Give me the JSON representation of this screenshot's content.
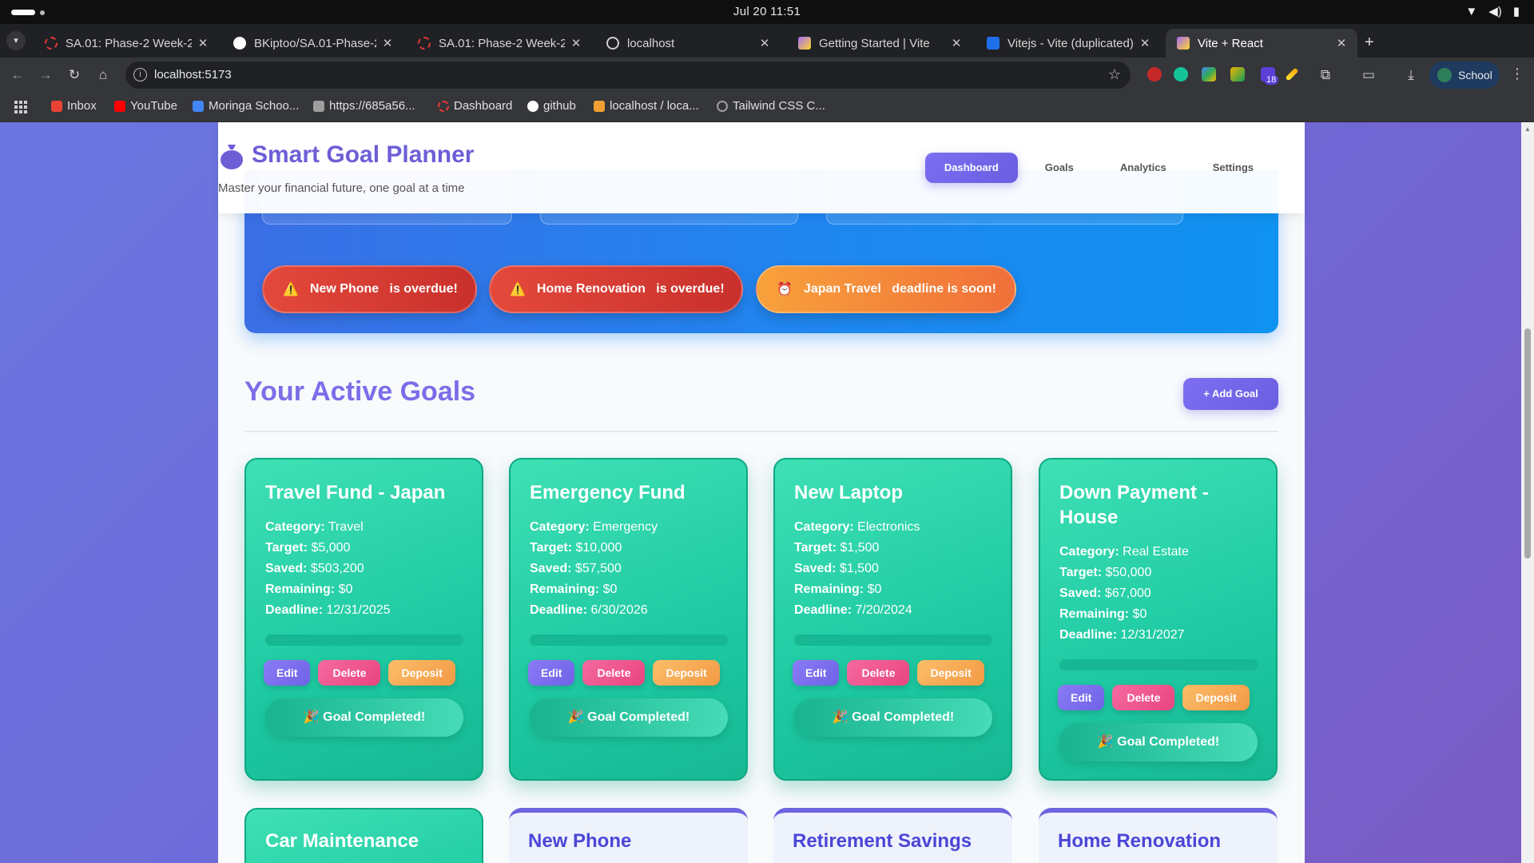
{
  "os": {
    "clock": "Jul 20  11:51"
  },
  "browser": {
    "tabs": [
      {
        "title": "SA.01: Phase-2 Week-2 C",
        "color": "#e53935"
      },
      {
        "title": "BKiptoo/SA.01-Phase-2-W",
        "color": "#ffffff"
      },
      {
        "title": "SA.01: Phase-2 Week-2 C",
        "color": "#e53935"
      },
      {
        "title": "localhost",
        "color": "#cfcfcf"
      },
      {
        "title": "Getting Started | Vite",
        "color": "#a86cf5"
      },
      {
        "title": "Vitejs - Vite (duplicated)",
        "color": "#1f6feb"
      },
      {
        "title": "Vite + React",
        "color": "#a86cf5"
      }
    ],
    "url": "localhost:5173",
    "extension_badge": "18",
    "profile_label": "School",
    "bookmarks": [
      {
        "label": "Inbox",
        "color": "#ea4335"
      },
      {
        "label": "YouTube",
        "color": "#ff0000"
      },
      {
        "label": "Moringa Schoo...",
        "color": "#4285f4"
      },
      {
        "label": "https://685a56...",
        "color": "#9e9e9e"
      },
      {
        "label": "Dashboard",
        "color": "#e53935"
      },
      {
        "label": "github",
        "color": "#ffffff"
      },
      {
        "label": "localhost / loca...",
        "color": "#f0a030"
      },
      {
        "label": "Tailwind CSS C...",
        "color": "#9e9e9e"
      }
    ]
  },
  "app": {
    "title": "Smart Goal Planner",
    "subtitle": "Master your financial future, one goal at a time",
    "nav": [
      "Dashboard",
      "Goals",
      "Analytics",
      "Settings"
    ],
    "active_nav": "Dashboard",
    "alerts": [
      {
        "goal": "New Phone",
        "message": "is overdue!",
        "type": "overdue"
      },
      {
        "goal": "Home Renovation",
        "message": "is overdue!",
        "type": "overdue"
      },
      {
        "goal": "Japan Travel",
        "message": "deadline is soon!",
        "type": "soon"
      }
    ],
    "section_title": "Your Active Goals",
    "add_goal_label": "+ Add Goal",
    "field_labels": {
      "category": "Category:",
      "target": "Target:",
      "saved": "Saved:",
      "remaining": "Remaining:",
      "deadline": "Deadline:"
    },
    "button_labels": {
      "edit": "Edit",
      "delete": "Delete",
      "deposit": "Deposit"
    },
    "completed_label": "🎉 Goal Completed!",
    "goals": [
      {
        "name": "Travel Fund - Japan",
        "category": "Travel",
        "target": "$5,000",
        "saved": "$503,200",
        "remaining": "$0",
        "deadline": "12/31/2025",
        "progress": 1.0
      },
      {
        "name": "Emergency Fund",
        "category": "Emergency",
        "target": "$10,000",
        "saved": "$57,500",
        "remaining": "$0",
        "deadline": "6/30/2026",
        "progress": 1.0
      },
      {
        "name": "New Laptop",
        "category": "Electronics",
        "target": "$1,500",
        "saved": "$1,500",
        "remaining": "$0",
        "deadline": "7/20/2024",
        "progress": 1.0
      },
      {
        "name": "Down Payment - House",
        "category": "Real Estate",
        "target": "$50,000",
        "saved": "$67,000",
        "remaining": "$0",
        "deadline": "12/31/2027",
        "progress": 1.0
      }
    ],
    "next_goals": [
      "Car Maintenance",
      "New Phone",
      "Retirement Savings",
      "Home Renovation"
    ]
  }
}
